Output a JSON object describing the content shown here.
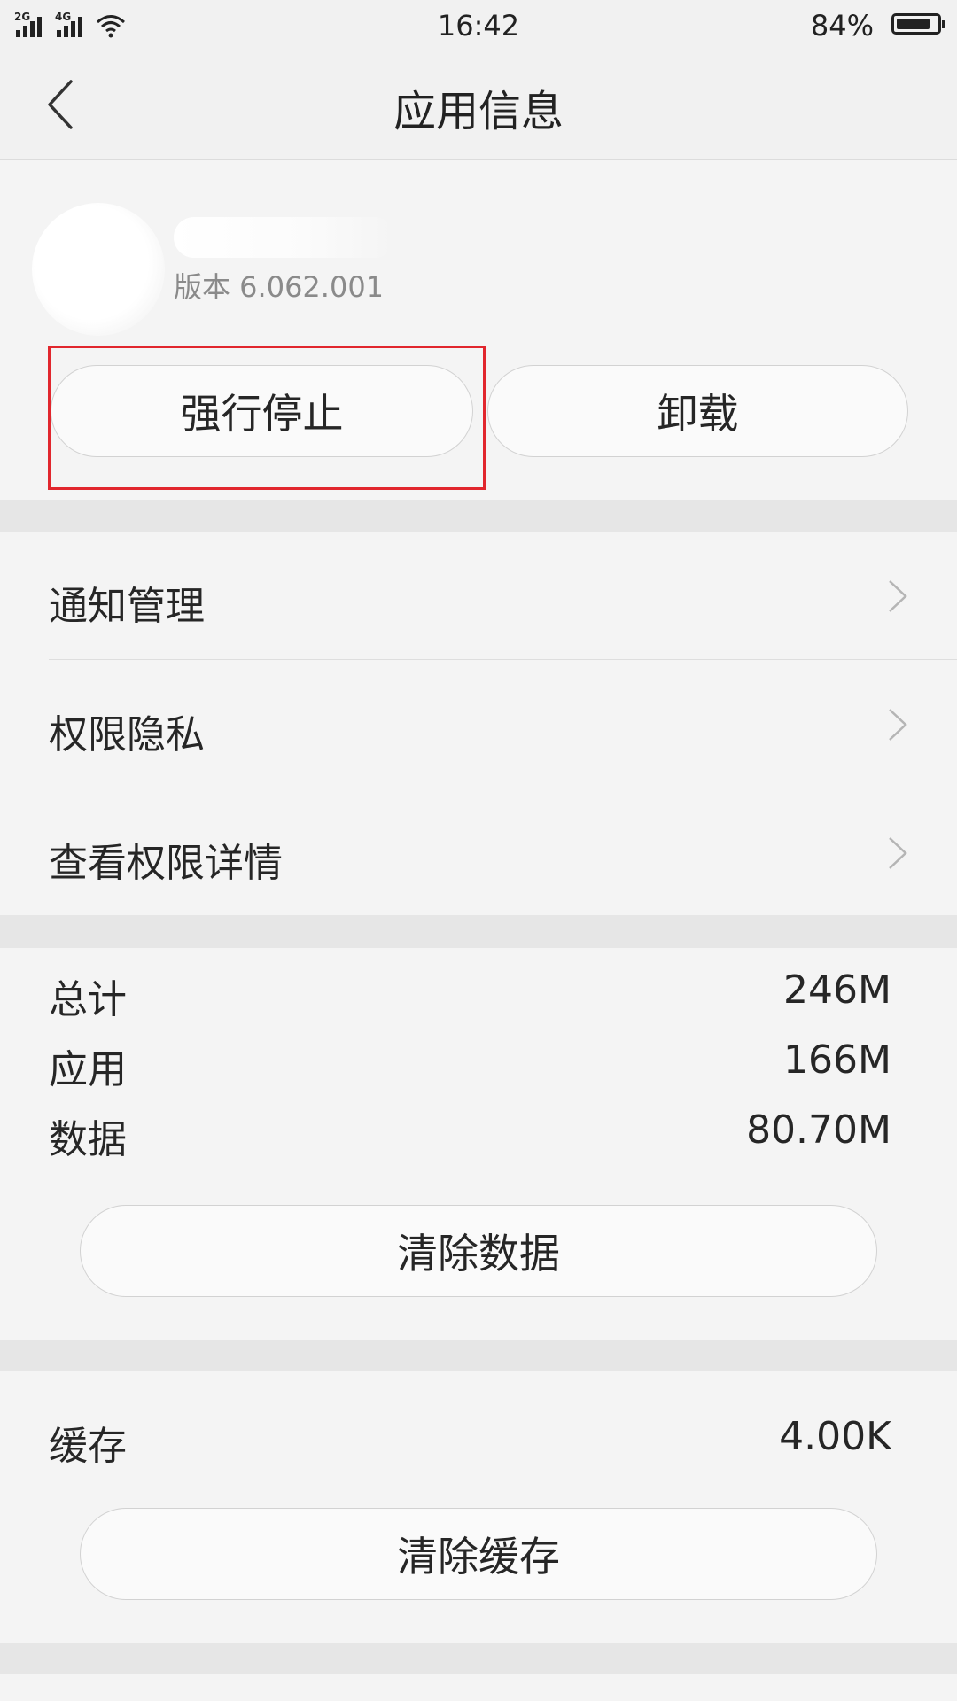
{
  "status_bar": {
    "network_1": "2G",
    "network_2": "4G",
    "time": "16:42",
    "battery_percent_text": "84%",
    "battery_level": 0.84,
    "icons": [
      "signal-icon",
      "signal-icon",
      "wifi-icon",
      "battery-icon"
    ]
  },
  "nav": {
    "title": "应用信息",
    "back_icon": "chevron-left-icon"
  },
  "app": {
    "version": "版本 6.062.001"
  },
  "actions": {
    "force_stop": "强行停止",
    "uninstall": "卸载"
  },
  "menu": {
    "items": [
      {
        "label": "通知管理"
      },
      {
        "label": "权限隐私"
      },
      {
        "label": "查看权限详情"
      }
    ]
  },
  "storage": {
    "total_label": "总计",
    "total_value": "246M",
    "app_label": "应用",
    "app_value": "166M",
    "data_label": "数据",
    "data_value": "80.70M",
    "clear_data": "清除数据"
  },
  "cache": {
    "label": "缓存",
    "value": "4.00K",
    "clear_cache": "清除缓存"
  },
  "colors": {
    "highlight": "#e1262d",
    "background": "#f4f4f4",
    "section_gap": "#e6e6e6"
  }
}
